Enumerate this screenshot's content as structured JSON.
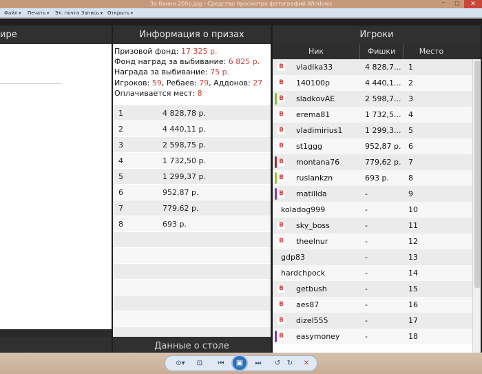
{
  "window": {
    "title": "За банкн 200р.jpg - Средство просмотра фотографий Windows",
    "min_label": "–",
    "max_label": "□",
    "close_label": "✕"
  },
  "menu": [
    {
      "label": "Файл"
    },
    {
      "label": "Печать"
    },
    {
      "label": "Эл. почта"
    },
    {
      "label": "Запись"
    },
    {
      "label": "Открыть"
    }
  ],
  "tourney_panel": {
    "header": "ире",
    "footer": ""
  },
  "prize_panel": {
    "header": "Информация о призах",
    "footer": "Данные о столе",
    "prize_fund_label": "Призовой фонд:",
    "prize_fund_value": "17 325 р.",
    "ko_fund_label": "Фонд наград за выбивание:",
    "ko_fund_value": "6 825 р.",
    "ko_reward_label": "Награда за выбивание:",
    "ko_reward_value": "75 р.",
    "players_label": "Игроков:",
    "players_value": "59",
    "rebuys_label": ", Ребаев:",
    "rebuys_value": "79",
    "addons_label": ", Аддонов:",
    "addons_value": "27",
    "paid_label": "Оплачивается мест:",
    "paid_value": "8",
    "prizes": [
      {
        "pos": "1",
        "amount": "4 828,78 р."
      },
      {
        "pos": "2",
        "amount": "4 440,11 р."
      },
      {
        "pos": "3",
        "amount": "2 598,75 р."
      },
      {
        "pos": "4",
        "amount": "1 732,50 р."
      },
      {
        "pos": "5",
        "amount": "1 299,37 р."
      },
      {
        "pos": "6",
        "amount": "952,87 р."
      },
      {
        "pos": "7",
        "amount": "779,62 р."
      },
      {
        "pos": "8",
        "amount": "693 р."
      }
    ]
  },
  "players_panel": {
    "header": "Игроки",
    "col_nick": "Ник",
    "col_chips": "Фишки",
    "col_place": "Место",
    "badge_letter": "B",
    "players": [
      {
        "nick": "vladika33",
        "chips": "4 828,7...",
        "place": "1",
        "badge": true,
        "stripe": ""
      },
      {
        "nick": "140100p",
        "chips": "4 440,1...",
        "place": "2",
        "badge": true,
        "stripe": ""
      },
      {
        "nick": "sladkovAE",
        "chips": "2 598,7...",
        "place": "3",
        "badge": true,
        "stripe": "#7fc241"
      },
      {
        "nick": "erema81",
        "chips": "1 732,5...",
        "place": "4",
        "badge": true,
        "stripe": ""
      },
      {
        "nick": "vladimirius1",
        "chips": "1 299,3...",
        "place": "5",
        "badge": true,
        "stripe": ""
      },
      {
        "nick": "st1ggg",
        "chips": "952,87 р.",
        "place": "6",
        "badge": true,
        "stripe": ""
      },
      {
        "nick": "montana76",
        "chips": "779,62 р.",
        "place": "7",
        "badge": true,
        "stripe": "#b02a2a"
      },
      {
        "nick": "ruslankzn",
        "chips": "693 р.",
        "place": "8",
        "badge": true,
        "stripe": "#9ac53c"
      },
      {
        "nick": "matillda",
        "chips": "-",
        "place": "9",
        "badge": true,
        "stripe": "#8e3aa8"
      },
      {
        "nick": "koladog999",
        "chips": "-",
        "place": "10",
        "badge": false,
        "stripe": ""
      },
      {
        "nick": "sky_boss",
        "chips": "-",
        "place": "11",
        "badge": true,
        "stripe": ""
      },
      {
        "nick": "theelnur",
        "chips": "-",
        "place": "12",
        "badge": true,
        "stripe": ""
      },
      {
        "nick": "gdp83",
        "chips": "-",
        "place": "13",
        "badge": false,
        "stripe": ""
      },
      {
        "nick": "hardchpock",
        "chips": "-",
        "place": "14",
        "badge": false,
        "stripe": ""
      },
      {
        "nick": "getbush",
        "chips": "-",
        "place": "15",
        "badge": true,
        "stripe": ""
      },
      {
        "nick": "aes87",
        "chips": "-",
        "place": "16",
        "badge": true,
        "stripe": ""
      },
      {
        "nick": "dizel555",
        "chips": "-",
        "place": "17",
        "badge": true,
        "stripe": ""
      },
      {
        "nick": "easymoney",
        "chips": "-",
        "place": "18",
        "badge": true,
        "stripe": "#8e3aa8"
      }
    ]
  },
  "toolbar": {
    "icons": [
      "zoom-icon",
      "fit-icon",
      "previous-icon",
      "slideshow-icon",
      "next-icon",
      "rotate-left-icon",
      "rotate-right-icon",
      "delete-icon"
    ],
    "zoom_glyph": "⊙▾",
    "fit_glyph": "⊡",
    "prev_glyph": "⏮",
    "slideshow_glyph": "▣",
    "next_glyph": "⏭",
    "rotl_glyph": "↺",
    "rotr_glyph": "↻",
    "delete_glyph": "✕"
  }
}
